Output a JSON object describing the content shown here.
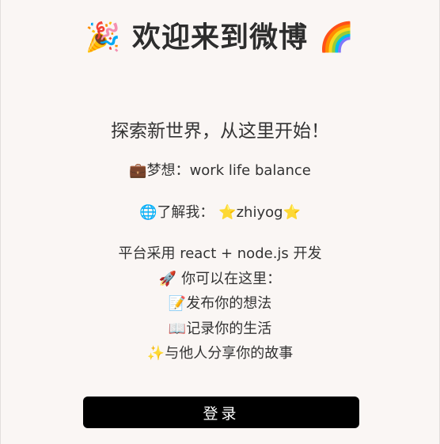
{
  "header": {
    "emoji_left": "🎉",
    "title": "欢迎来到微博",
    "emoji_right": "🌈"
  },
  "subtitle": "探索新世界，从这里开始！",
  "dream": {
    "emoji": "💼",
    "label": "梦想：",
    "value": "work life balance"
  },
  "about": {
    "emoji": "🌐",
    "label": "了解我：",
    "star_left": "⭐",
    "name": "zhiyog",
    "star_right": "⭐"
  },
  "tech_line": "平台采用 react + node.js 开发",
  "intro": {
    "emoji": "🚀",
    "text": "你可以在这里："
  },
  "features": [
    {
      "emoji": "📝",
      "text": "发布你的想法"
    },
    {
      "emoji": "📖",
      "text": "记录你的生活"
    },
    {
      "emoji": "✨",
      "text": "与他人分享你的故事"
    }
  ],
  "login_button": "登录",
  "colors": {
    "background": "#faf6f4",
    "text": "#333333",
    "button_bg": "#000000",
    "button_text": "#ffffff"
  }
}
